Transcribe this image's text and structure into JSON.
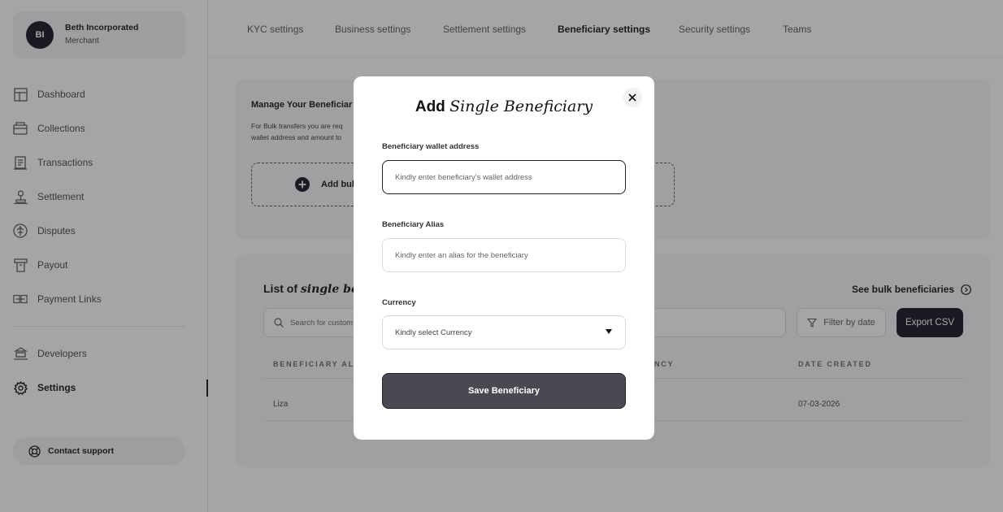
{
  "profile": {
    "initials": "BI",
    "name": "Beth Incorporated",
    "role": "Merchant"
  },
  "sidebar": {
    "items": [
      {
        "label": "Dashboard",
        "icon": "dashboard-icon"
      },
      {
        "label": "Collections",
        "icon": "collections-icon"
      },
      {
        "label": "Transactions",
        "icon": "transactions-icon"
      },
      {
        "label": "Settlement",
        "icon": "settlement-icon"
      },
      {
        "label": "Disputes",
        "icon": "disputes-icon"
      },
      {
        "label": "Payout",
        "icon": "payout-icon"
      },
      {
        "label": "Payment Links",
        "icon": "payment-links-icon"
      }
    ],
    "secondary": [
      {
        "label": "Developers",
        "icon": "developers-icon"
      },
      {
        "label": "Settings",
        "icon": "gear-icon",
        "active": true
      }
    ],
    "support_label": "Contact support"
  },
  "tabs": [
    {
      "label": "KYC settings"
    },
    {
      "label": "Business settings"
    },
    {
      "label": "Settlement settings"
    },
    {
      "label": "Beneficiary settings",
      "active": true
    },
    {
      "label": "Security settings"
    },
    {
      "label": "Teams"
    }
  ],
  "manage": {
    "title": "Manage Your Beneficiar",
    "desc_line1": "For Bulk transfers you are req",
    "desc_line2": "wallet address and amount to",
    "add_bulk_label": "Add bul"
  },
  "list": {
    "title_prefix": "List of",
    "title_italic": "single bene",
    "see_bulk_label": "See bulk beneficiaries",
    "search_placeholder": "Search for custom",
    "filter_label": "Filter by date",
    "export_label": "Export CSV",
    "headers": [
      "BENEFICIARY ALIA",
      "NCY",
      "DATE CREATED"
    ],
    "rows": [
      {
        "alias": "Liza",
        "date": "07-03-2026"
      }
    ]
  },
  "modal": {
    "title_prefix": "Add",
    "title_italic": "Single Beneficiary",
    "wallet_label": "Beneficiary wallet address",
    "wallet_placeholder": "Kindly enter beneficiary's wallet address",
    "alias_label": "Beneficiary Alias",
    "alias_placeholder": "Kindly enter an alias for the beneficiary",
    "currency_label": "Currency",
    "currency_value": "Kindly select Currency",
    "save_label": "Save Beneficiary"
  },
  "colors": {
    "primary": "#12101a",
    "overlay": "#28282e",
    "save_button": "#4a4850"
  }
}
